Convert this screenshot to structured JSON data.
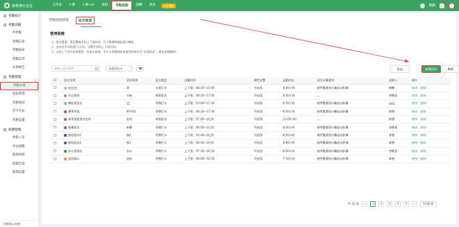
{
  "app": {
    "company": "系统演示企业"
  },
  "nav": {
    "items": [
      "工作台",
      "人事",
      "人事-old",
      "组织",
      "考勤假期",
      "薪酬",
      "更多"
    ],
    "active_index": 4,
    "promo": "点击领取"
  },
  "topbar": {
    "user": "韩鹏"
  },
  "sidebar": {
    "groups": [
      {
        "label": "考勤统计",
        "subs": []
      },
      {
        "label": "考勤日报",
        "subs": [
          "月考勤",
          "明细记录",
          "考勤报表",
          "考勤异常",
          "补假报告"
        ]
      },
      {
        "label": "考勤管理",
        "subs": [
          "考勤分组",
          "班组管理",
          "考勤规则",
          "打卡方式",
          "考勤设置"
        ]
      },
      {
        "label": "假期管理",
        "subs": [
          "休假一览",
          "手动调整",
          "假期余额",
          "假期方案",
          "假期设置"
        ]
      }
    ],
    "active_sub": "考勤分组",
    "footer": "切换演示系统"
  },
  "tabs": [
    "考勤班组管理",
    "班次管理"
  ],
  "active_tab": "班次管理",
  "guide": {
    "title": "使用指南",
    "lines": [
      "1、班次管理：是设置每天的上下班时间、打卡数据将据此进行解析。",
      "2、支持为不同的部门/人员、设置不同的上下班时间。",
      "3、过去三个月内均未使用，应加以复核，不打卡考勤结构未使用的班次为\"无用班次\"，建议定期删除。"
    ]
  },
  "toolbar": {
    "search_placeholder": "请输入班次搜索",
    "select_value": "全部班次",
    "export": "导出",
    "add": "新增班次",
    "delete": "删除"
  },
  "table": {
    "headers": [
      "班次名称",
      "班次简称",
      "班次类型",
      "出勤时间",
      "弹性设置",
      "出勤时长",
      "班次计算规则",
      "创建人",
      "操作"
    ],
    "rows": [
      {
        "color": "#e0a5c5",
        "name": "红红红",
        "short": "网",
        "type": "分段打卡",
        "time": "上下班：08:30~12:00",
        "flex": "不启用",
        "hours": "8.00小时",
        "rule": "按考勤规则计算自动折算",
        "creator": "韩鹏",
        "ops": [
          "修改",
          "复制"
        ]
      },
      {
        "color": "#a0a0a0",
        "name": "节日休息",
        "short": "节休",
        "type": "休息班次",
        "time": "上下班：08:30~17:30",
        "flex": "不启用",
        "hours": "8.00小时",
        "rule": "—",
        "creator": "李朝直",
        "ops": [
          "修改",
          "复制"
        ]
      },
      {
        "color": "#7cc690",
        "name": "哺乳假班次",
        "short": "11",
        "type": "早晚打卡",
        "time": "上下班：10:00~17:30",
        "flex": "不启用",
        "hours": "6.50小时",
        "rule": "按考勤规则计算自动折算",
        "creator": "HRS",
        "ops": [
          "修改",
          "复制"
        ]
      },
      {
        "color": "#d65b3f",
        "name": "春季早班",
        "short": "KF早班",
        "type": "早晚打卡",
        "time": "上下班：08:30~17:30",
        "flex": "不启用",
        "hours": "8.00小时",
        "rule": "按考勤规则计算自动折算",
        "creator": "郝艳",
        "ops": [
          "修改",
          "复制"
        ]
      },
      {
        "color": "#888888",
        "name": "休息加班班次金时",
        "short": "金时",
        "type": "休息班次",
        "time": "上下班：07:00~次日0",
        "flex": "不启用",
        "hours": "23.00小时",
        "rule": "—",
        "creator": "郝艳",
        "ops": [
          "修改",
          "复制"
        ]
      },
      {
        "color": "#9b59b6",
        "name": "新晚班次",
        "short": "新晚",
        "type": "早晚打卡",
        "time": "上下班：08:00~次日0",
        "flex": "不启用",
        "hours": "8.00小时",
        "rule": "按考勤规则计算自动折算",
        "creator": "李朝直",
        "ops": [
          "修改",
          "复制"
        ]
      },
      {
        "color": "#6b4c9a",
        "name": "夜班班次2",
        "short": "夜2",
        "type": "早晚打卡",
        "time": "上下班：16:30~次日0",
        "flex": "不启用",
        "hours": "8.00小时",
        "rule": "按考勤规则计算自动折算",
        "creator": "郝艳",
        "ops": [
          "修改",
          "复制"
        ]
      },
      {
        "color": "#4a6fa5",
        "name": "夜班班次1",
        "short": "夜1",
        "type": "早晚打卡",
        "time": "上下班：08:30~次日0",
        "flex": "不启用",
        "hours": "8.00小时",
        "rule": "按考勤规则计算自动折算",
        "creator": "郝艳",
        "ops": [
          "修改",
          "复制"
        ]
      },
      {
        "color": "#3aa463",
        "name": "办公室班次",
        "short": "办公",
        "type": "早晚打卡",
        "time": "上下班：07:30~16:30",
        "flex": "不启用",
        "hours": "8.00小时",
        "rule": "按考勤规则计算自动折算",
        "creator": "李朝直",
        "ops": [
          "修改",
          "复制"
        ]
      },
      {
        "color": "#e89b3c",
        "name": "加班展示",
        "short": "加班",
        "type": "早晚打卡",
        "time": "上下班：08:00~16:30",
        "flex": "不启用",
        "hours": "7.50小时",
        "rule": "按考勤规则计算自动折算",
        "creator": "郝艳",
        "ops": [
          "修改",
          "复制"
        ]
      }
    ]
  },
  "pager": {
    "total": "共 42 条",
    "pages": [
      "1",
      "2",
      "3",
      "4",
      "5"
    ],
    "active": "1",
    "size": "10条/页"
  },
  "colors": {
    "brand": "#3aa463",
    "highlight": "#e23a3a"
  }
}
